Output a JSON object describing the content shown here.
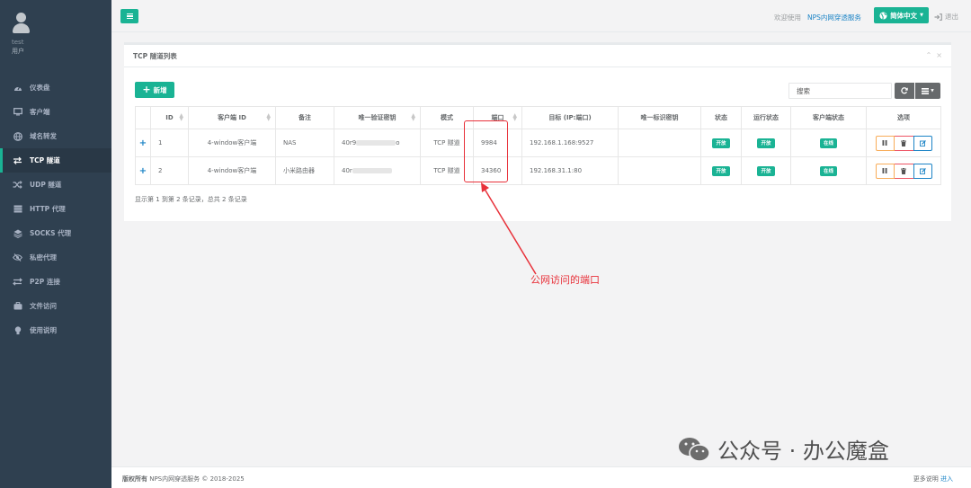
{
  "sidebar": {
    "username": "test",
    "role": "用户",
    "items": [
      {
        "label": "仪表盘",
        "icon": "dashboard-icon"
      },
      {
        "label": "客户端",
        "icon": "monitor-icon"
      },
      {
        "label": "域名转发",
        "icon": "globe-icon"
      },
      {
        "label": "TCP 隧道",
        "icon": "tcp-arrows-icon",
        "active": true
      },
      {
        "label": "UDP 隧道",
        "icon": "shuffle-icon"
      },
      {
        "label": "HTTP 代理",
        "icon": "server-icon"
      },
      {
        "label": "SOCKS 代理",
        "icon": "layers-icon"
      },
      {
        "label": "私密代理",
        "icon": "eye-slash-icon"
      },
      {
        "label": "P2P 连接",
        "icon": "exchange-icon"
      },
      {
        "label": "文件访问",
        "icon": "briefcase-icon"
      },
      {
        "label": "使用说明",
        "icon": "lightbulb-icon"
      }
    ]
  },
  "topbar": {
    "welcome": "欢迎使用",
    "brand": "NPS内网穿透服务",
    "language": "简体中文",
    "logout": "退出"
  },
  "panel": {
    "title": "TCP 隧道列表",
    "add_label": "新增",
    "search_placeholder": "搜索",
    "columns": [
      "ID",
      "客户端 ID",
      "备注",
      "唯一验证密钥",
      "模式",
      "端口",
      "目标 (IP:端口)",
      "唯一标识密钥",
      "状态",
      "运行状态",
      "客户端状态",
      "选项"
    ],
    "rows": [
      {
        "id": "1",
        "client": "4-window客户端",
        "remark": "NAS",
        "key": "40r9",
        "key_tail": "o",
        "mode": "TCP 隧道",
        "port": "9984",
        "target": "192.168.1.168:9527",
        "uid": "",
        "status": "开放",
        "run": "开放",
        "client_status": "在线"
      },
      {
        "id": "2",
        "client": "4-window客户端",
        "remark": "小米路由器",
        "key": "40r",
        "key_tail": "",
        "mode": "TCP 隧道",
        "port": "34360",
        "target": "192.168.31.1:80",
        "uid": "",
        "status": "开放",
        "run": "开放",
        "client_status": "在线"
      }
    ],
    "pagination": "显示第 1 到第 2 条记录，总共 2 条记录"
  },
  "annotation": {
    "text": "公网访问的端口",
    "color": "#e8313a"
  },
  "watermark": "公众号 · 办公魔盒",
  "footer": {
    "copyright_bold": "版权所有",
    "copyright": " NPS内网穿透服务 © 2018-2025",
    "more": "更多说明",
    "more_link": "进入"
  },
  "colors": {
    "sidebar": "#2f4050",
    "primary": "#1ab394",
    "link": "#1c84c6",
    "warning": "#f8ac59",
    "danger": "#ed5565"
  }
}
